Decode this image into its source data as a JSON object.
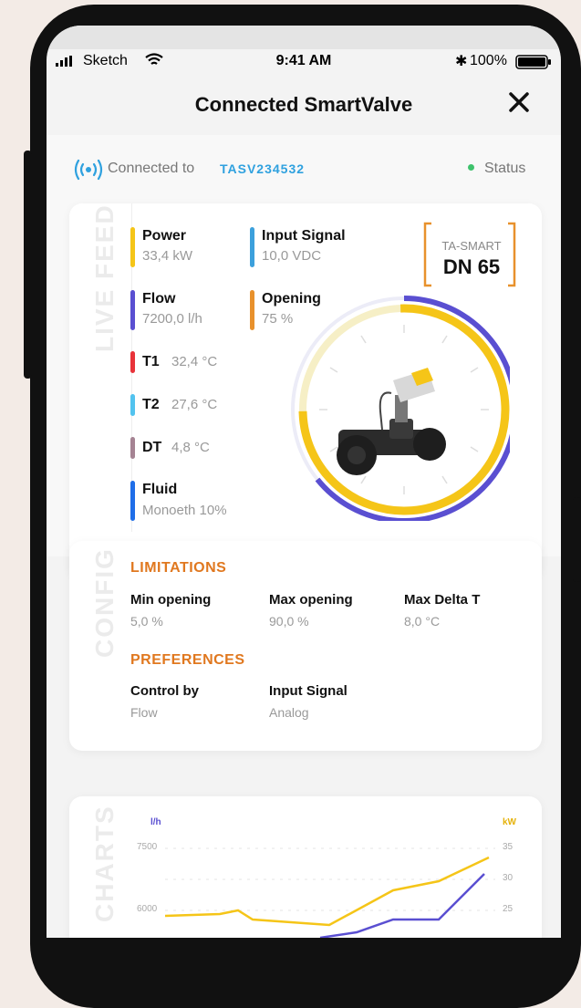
{
  "status_bar": {
    "carrier": "Sketch",
    "time": "9:41 AM",
    "battery": "100%"
  },
  "header": {
    "title": "Connected SmartValve"
  },
  "connection": {
    "prefix": "Connected to",
    "device_id": "TASV234532",
    "status": "Status"
  },
  "live_feed": {
    "label": "LIVE FEED",
    "items": [
      {
        "name": "Power",
        "value": "33,4 kW"
      },
      {
        "name": "Input Signal",
        "value": "10,0 VDC"
      },
      {
        "name": "Flow",
        "value": "7200,0 l/h"
      },
      {
        "name": "Opening",
        "value": "75 %"
      },
      {
        "name": "T1",
        "value": "32,4 °C"
      },
      {
        "name": "T2",
        "value": "27,6 °C"
      },
      {
        "name": "DT",
        "value": "4,8 °C"
      },
      {
        "name": "Fluid",
        "value": "Monoeth 10%"
      }
    ],
    "model_top": "TA-SMART",
    "model_size": "DN 65"
  },
  "config": {
    "label": "CONFIG",
    "limitations_title": "LIMITATIONS",
    "limitations": [
      {
        "label": "Min opening",
        "value": "5,0 %"
      },
      {
        "label": "Max opening",
        "value": "90,0 %"
      },
      {
        "label": "Max Delta T",
        "value": "8,0 °C"
      }
    ],
    "preferences_title": "PREFERENCES",
    "preferences": [
      {
        "label": "Control by",
        "value": "Flow"
      },
      {
        "label": "Input Signal",
        "value": "Analog"
      }
    ]
  },
  "charts": {
    "label": "CHARTS",
    "left_unit": "l/h",
    "right_unit": "kW",
    "left_ticks": [
      "7500",
      "6000"
    ],
    "right_ticks": [
      "35",
      "30",
      "25"
    ]
  },
  "colors": {
    "power": "#f5c518",
    "flow": "#5a4fd1",
    "input_signal": "#3ca0dc",
    "opening": "#e8912c",
    "t1": "#e8333a",
    "t2": "#52c3ef",
    "dt": "#a58393",
    "fluid": "#1f6ee8",
    "accent": "#e0781f"
  }
}
